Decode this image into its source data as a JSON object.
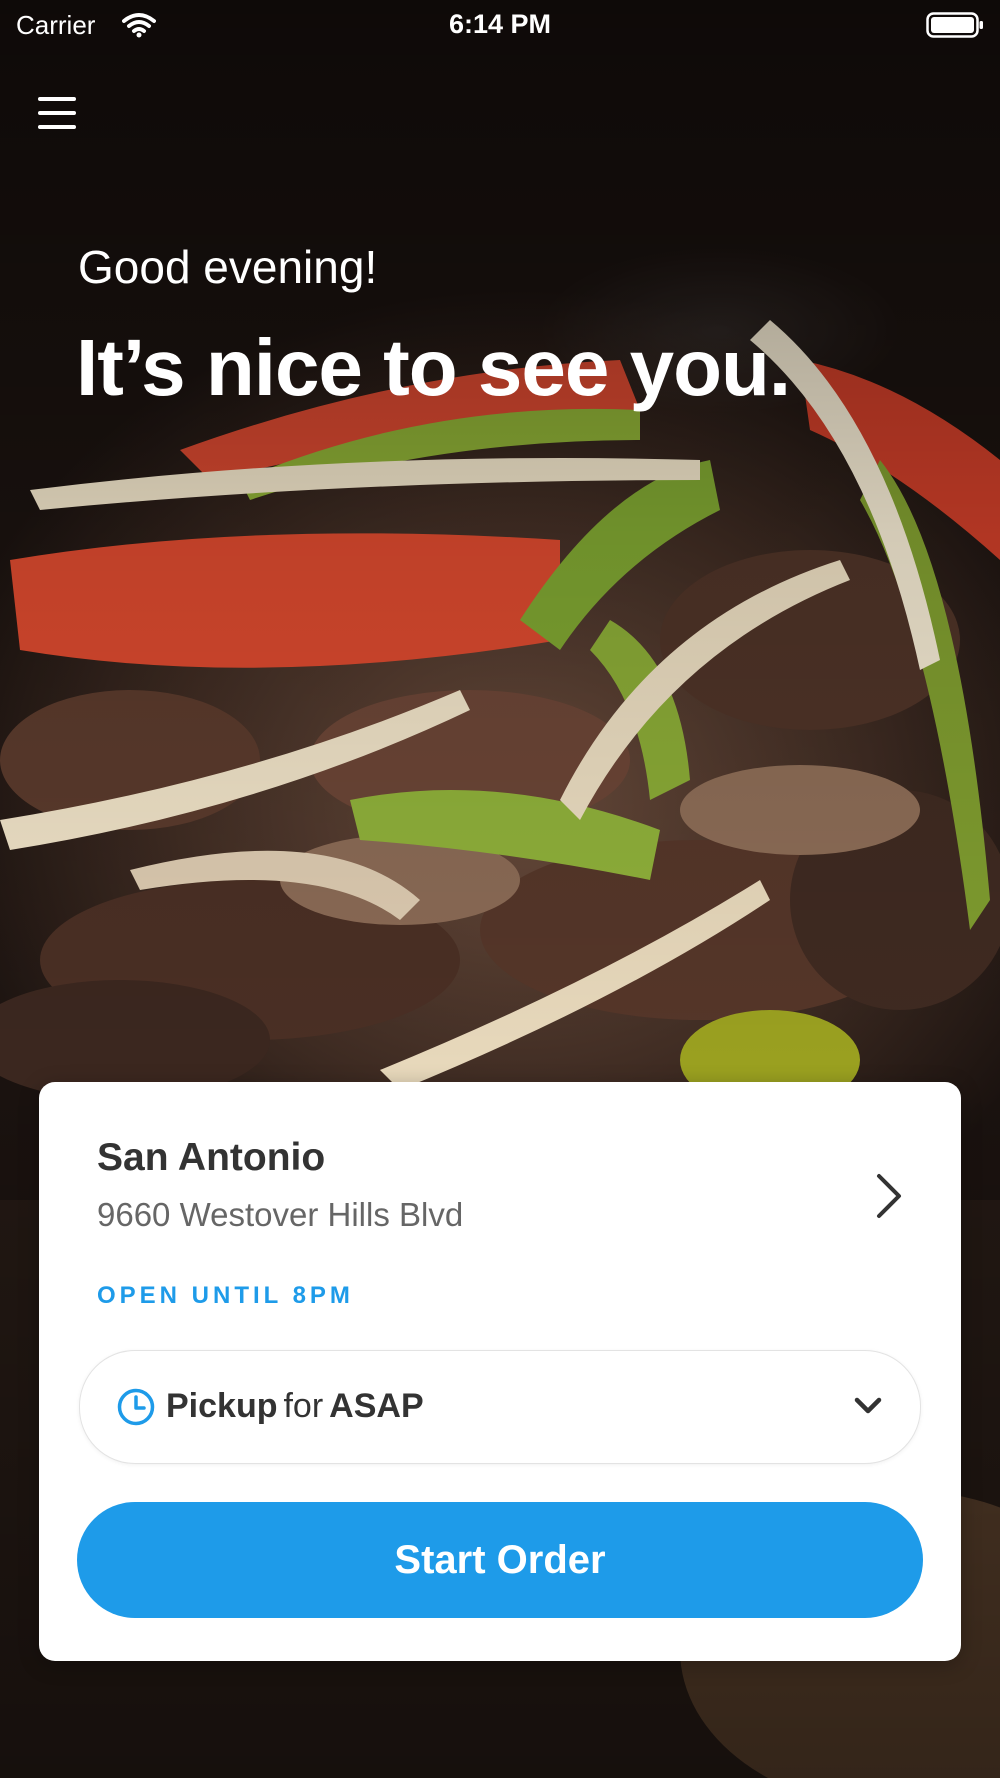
{
  "status_bar": {
    "carrier": "Carrier",
    "time": "6:14 PM"
  },
  "hero": {
    "greeting": "Good evening!",
    "headline": "It’s nice to see you."
  },
  "location": {
    "name": "San Antonio",
    "address": "9660 Westover Hills Blvd",
    "status": "OPEN UNTIL 8PM"
  },
  "order_mode": {
    "mode": "Pickup",
    "connector": "for",
    "time": "ASAP"
  },
  "actions": {
    "start_order": "Start Order"
  },
  "colors": {
    "accent": "#1e9be9",
    "card_background": "#ffffff",
    "primary_text": "#333333",
    "secondary_text": "#666666"
  },
  "icons": [
    "wifi-icon",
    "battery-icon",
    "menu-icon",
    "chevron-right-icon",
    "clock-icon",
    "chevron-down-icon"
  ]
}
